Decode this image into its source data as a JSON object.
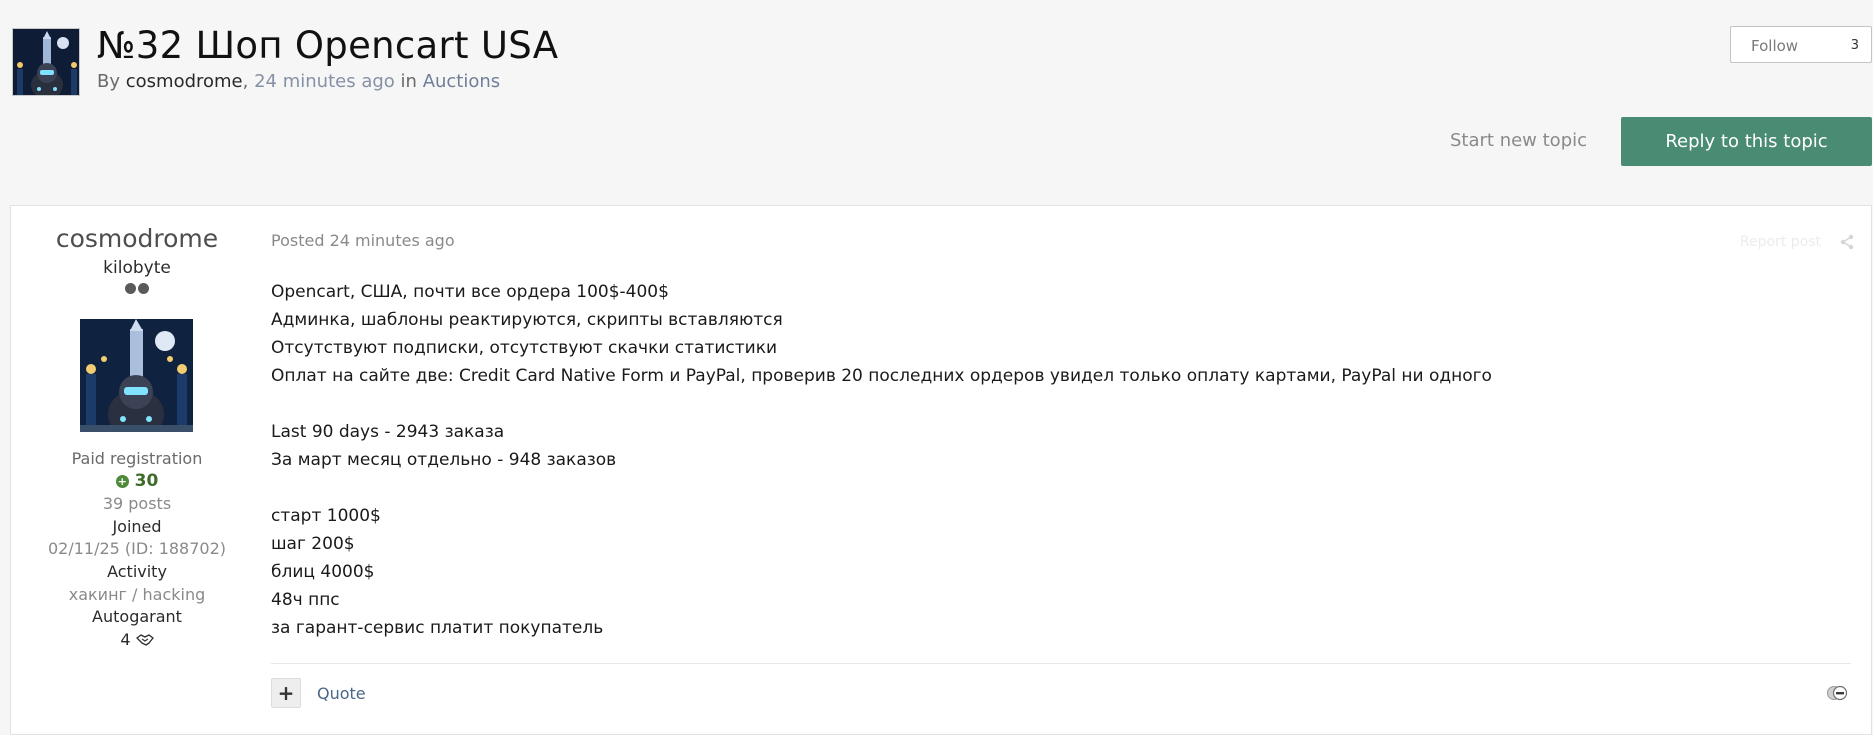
{
  "topic": {
    "title": "№32 Шоп Opencart USA",
    "by": "By",
    "author": "cosmodrome",
    "separator": ",",
    "time": "24 minutes ago",
    "in": "in",
    "forum": "Auctions"
  },
  "follow": {
    "label": "Follow",
    "count": "3"
  },
  "actions": {
    "start_topic": "Start new topic",
    "reply": "Reply to this topic"
  },
  "author": {
    "name": "cosmodrome",
    "rank": "kilobyte",
    "group": "Paid registration",
    "reputation": "30",
    "posts": "39 posts",
    "joined_label": "Joined",
    "joined_value": "02/11/25 (ID: 188702)",
    "activity_label": "Activity",
    "activity_value": "хакинг / hacking",
    "autogarant_label": "Autogarant",
    "autogarant_value": "4"
  },
  "post": {
    "posted": "Posted 24 minutes ago",
    "report": "Report post",
    "lines": [
      "Opencart, США, почти все ордера 100$-400$",
      "Админка, шаблоны реактируются, скрипты вставляются",
      "Отсутствуют подписки, отсутствуют скачки статистики",
      "Оплат на сайте две: Credit Card Native Form и PayPal, проверив 20 последних ордеров увидел только оплату картами, PayPal ни одного",
      "",
      "Last 90 days - 2943 заказа",
      "За март месяц отдельно - 948 заказов",
      "",
      "старт 1000$",
      "шаг 200$",
      "блиц 4000$",
      "48ч ппс",
      "за гарант-сервис платит покупатель"
    ],
    "quote": "Quote"
  },
  "colors": {
    "reply_button": "#4a8b74",
    "reputation": "#3e6b2a",
    "link": "#4a6788"
  }
}
